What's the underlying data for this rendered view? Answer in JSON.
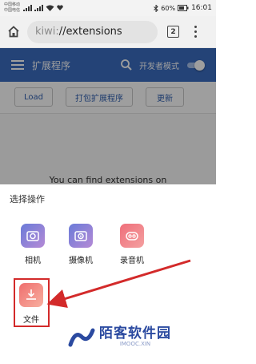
{
  "status_bar": {
    "carrier1": "中国移动",
    "carrier2": "中国电信",
    "battery": "60%",
    "time": "16:01"
  },
  "browser": {
    "url_scheme": "kiwi:",
    "url_path": "//extensions",
    "tab_count": "2"
  },
  "extensions_page": {
    "title": "扩展程序",
    "developer_mode_label": "开发者模式",
    "developer_mode_on": true,
    "buttons": {
      "load": "Load",
      "pack": "打包扩展程序",
      "update": "更新"
    },
    "hint_text": "You can find extensions on"
  },
  "action_sheet": {
    "title": "选择操作",
    "options": [
      {
        "label": "相机",
        "icon": "camera-icon"
      },
      {
        "label": "摄像机",
        "icon": "video-camera-icon"
      },
      {
        "label": "录音机",
        "icon": "voice-recorder-icon"
      },
      {
        "label": "文件",
        "icon": "file-download-icon"
      }
    ]
  },
  "watermark": {
    "text": "陌客软件园",
    "subtext": "IMOOC.XIN"
  },
  "colors": {
    "header_blue": "#3b6dc1",
    "annotation_red": "#d32a2a"
  }
}
